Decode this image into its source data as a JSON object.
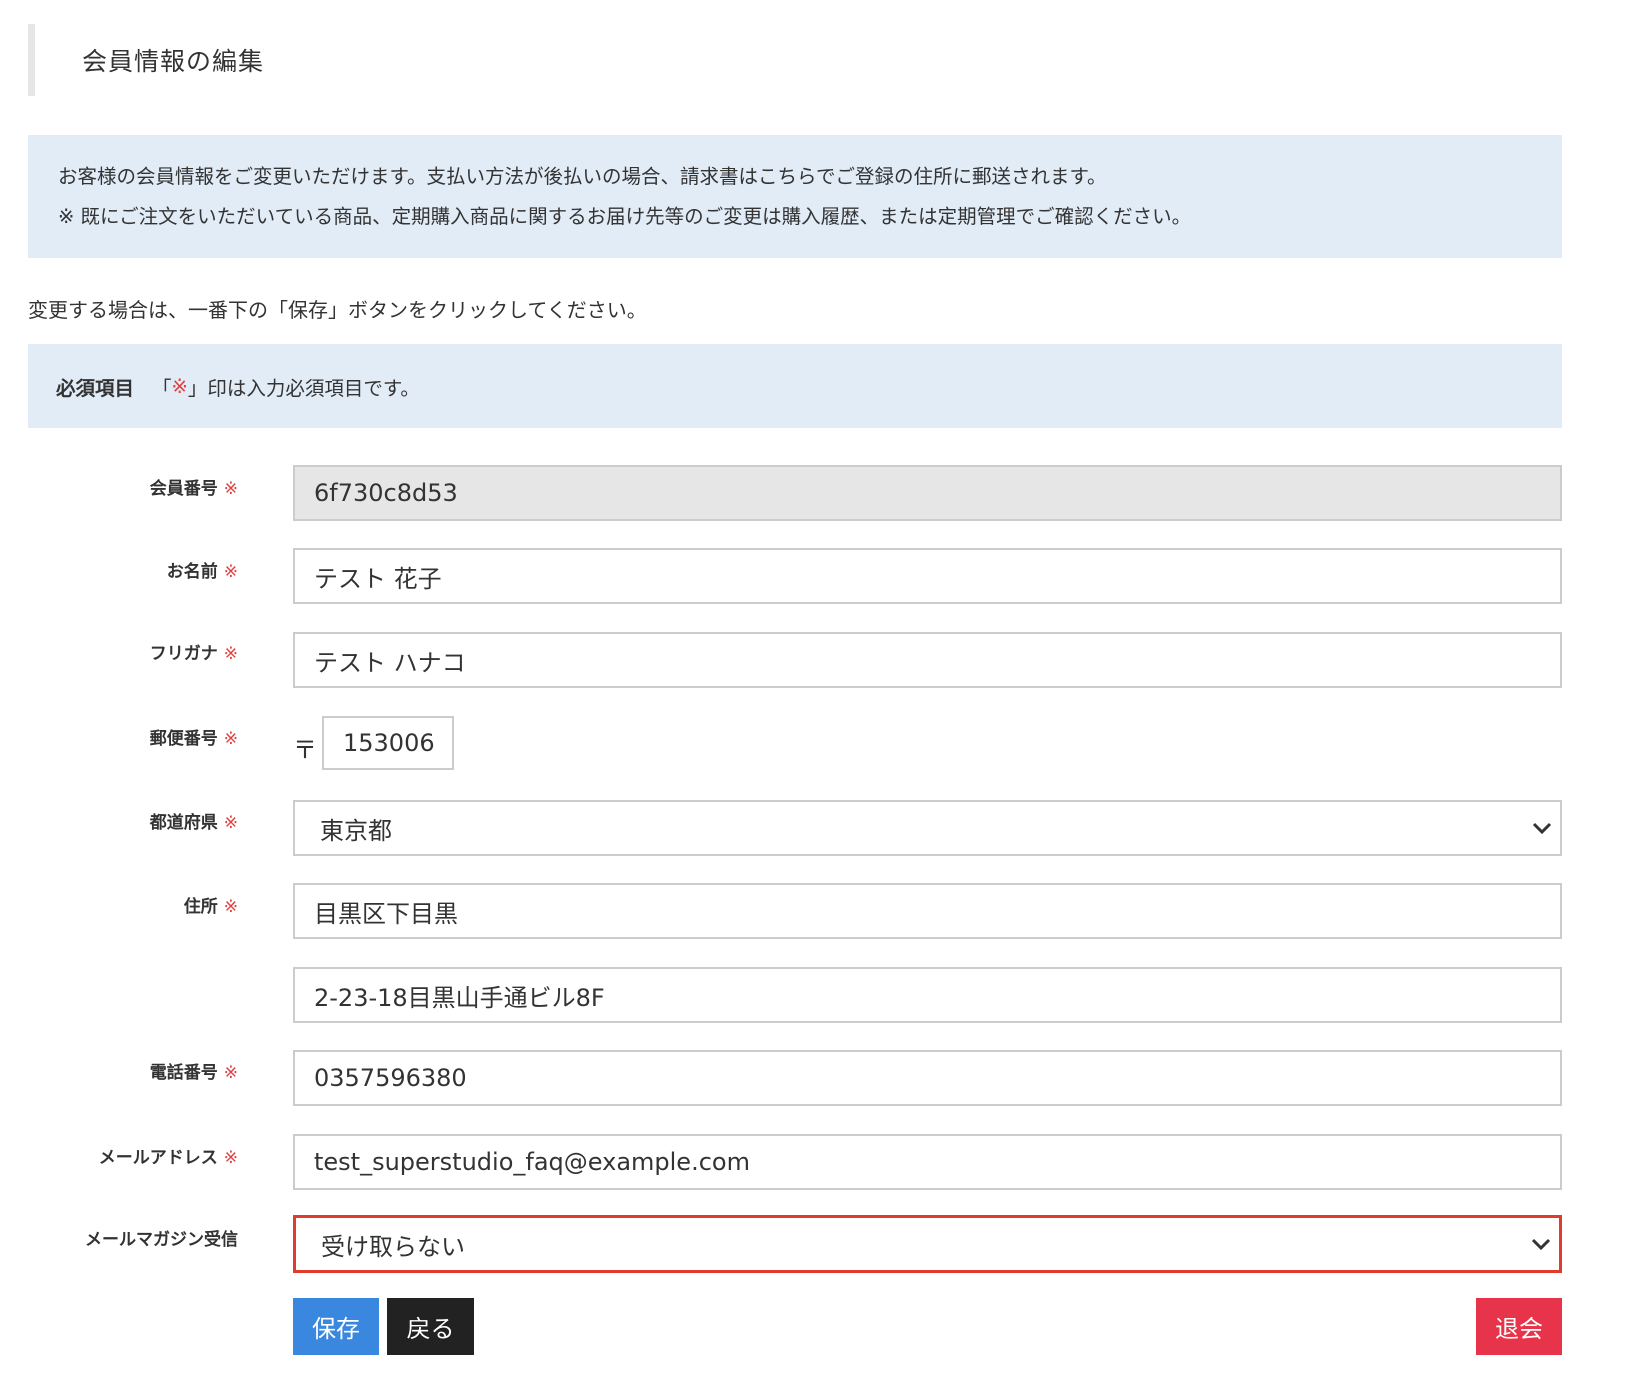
{
  "page": {
    "title": "会員情報の編集"
  },
  "info": {
    "line1": "お客様の会員情報をご変更いただけます。支払い方法が後払いの場合、請求書はこちらでご登録の住所に郵送されます。",
    "line2": "※ 既にご注文をいただいている商品、定期購入商品に関するお届け先等のご変更は購入履歴、または定期管理でご確認ください。"
  },
  "instruction": "変更する場合は、一番下の「保存」ボタンをクリックしてください。",
  "required_note": {
    "title": "必須項目",
    "open_bracket": "「",
    "mark": "※",
    "close_text": "」印は入力必須項目です。"
  },
  "required_mark": "※",
  "form": {
    "member_id": {
      "label": "会員番号",
      "value": "6f730c8d53"
    },
    "name": {
      "label": "お名前",
      "value": "テスト 花子"
    },
    "furigana": {
      "label": "フリガナ",
      "value": "テスト ハナコ"
    },
    "postal": {
      "label": "郵便番号",
      "prefix": "〒",
      "value": "153006"
    },
    "prefecture": {
      "label": "都道府県",
      "value": "東京都"
    },
    "address": {
      "label": "住所",
      "line1": "目黒区下目黒",
      "line2": "2-23-18目黒山手通ビル8F"
    },
    "phone": {
      "label": "電話番号",
      "value": "0357596380"
    },
    "email": {
      "label": "メールアドレス",
      "value": "test_superstudio_faq@example.com"
    },
    "newsletter": {
      "label": "メールマガジン受信",
      "value": "受け取らない"
    }
  },
  "buttons": {
    "save": "保存",
    "back": "戻る",
    "withdraw": "退会"
  },
  "colors": {
    "info_bg": "#e1ecf7",
    "required_mark": "#e04040",
    "save": "#3a87e0",
    "back": "#222222",
    "withdraw": "#e8344a",
    "highlight_border": "#e03c2e"
  }
}
